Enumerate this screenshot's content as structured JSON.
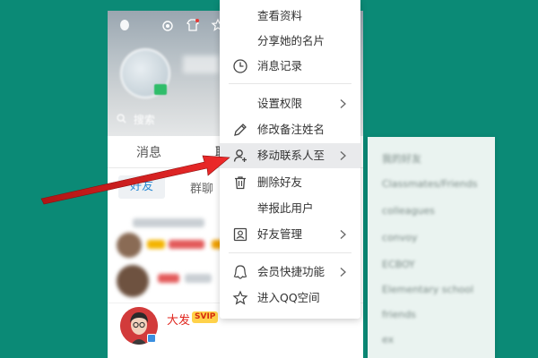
{
  "search": {
    "placeholder": "搜索"
  },
  "tabs": {
    "messages": "消息",
    "contacts_partial": "联"
  },
  "subtabs": {
    "friends": "好友",
    "groups": "群聊"
  },
  "contact": {
    "name": "大发",
    "badge": "SVIP"
  },
  "context_menu": {
    "items": [
      {
        "label": "查看资料"
      },
      {
        "label": "分享她的名片"
      },
      {
        "label": "消息记录",
        "icon": "clock-icon"
      },
      {
        "label": "设置权限",
        "submenu": true
      },
      {
        "label": "修改备注姓名",
        "icon": "pencil-icon"
      },
      {
        "label": "移动联系人至",
        "icon": "user-move-icon",
        "submenu": true,
        "highlighted": true
      },
      {
        "label": "删除好友",
        "icon": "trash-icon"
      },
      {
        "label": "举报此用户"
      },
      {
        "label": "好友管理",
        "icon": "user-card-icon",
        "submenu": true
      },
      {
        "label": "会员快捷功能",
        "icon": "qq-penguin-icon",
        "submenu": true
      },
      {
        "label": "进入QQ空间",
        "icon": "star-outline-icon"
      }
    ]
  },
  "submenu": {
    "items": [
      "我的好友",
      "Classmates/Friends",
      "colleagues",
      "convoy",
      "ECBOY",
      "Elementary school",
      "friends",
      "ex"
    ]
  },
  "colors": {
    "background": "#0b8a76",
    "highlight": "#e9eaec",
    "svip": "#ffd24a",
    "arrow": "#e01d1d"
  }
}
